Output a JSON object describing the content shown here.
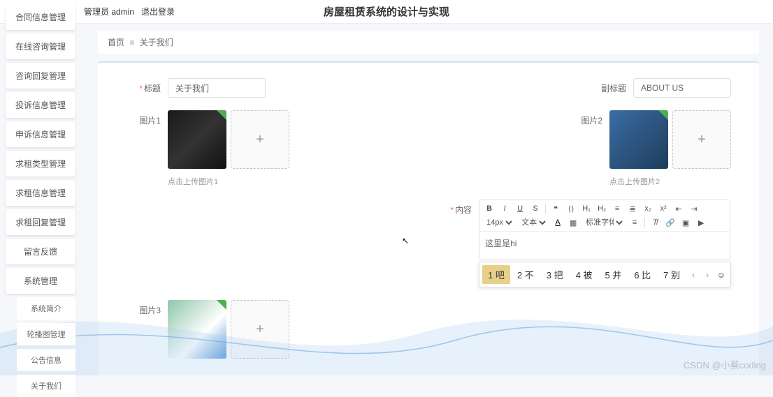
{
  "header": {
    "title": "房屋租赁系统的设计与实现",
    "user_label": "管理员 admin",
    "logout": "退出登录"
  },
  "sidebar": {
    "items": [
      "合同信息管理",
      "在线咨询管理",
      "咨询回复管理",
      "投诉信息管理",
      "申诉信息管理",
      "求租类型管理",
      "求租信息管理",
      "求租回复管理",
      "留言反馈",
      "系统管理"
    ],
    "subitems": [
      "系统简介",
      "轮播图管理",
      "公告信息",
      "关于我们"
    ]
  },
  "breadcrumb": {
    "root": "首页",
    "current": "关于我们"
  },
  "form": {
    "title_label": "标题",
    "title_value": "关于我们",
    "subtitle_label": "副标题",
    "subtitle_value": "ABOUT US",
    "img1_label": "图片1",
    "img1_hint": "点击上传图片1",
    "img2_label": "图片2",
    "img2_hint": "点击上传图片2",
    "img3_label": "图片3",
    "content_label": "内容",
    "required": "*"
  },
  "editor": {
    "font_size": "14px",
    "font_menu": "文本",
    "font_family": "标准字体",
    "body_text": "这里是hi"
  },
  "ime": {
    "candidates": [
      "1 吧",
      "2 不",
      "3 把",
      "4 被",
      "5 并",
      "6 比",
      "7 别"
    ]
  },
  "watermark": "CSDN @小蔡coding"
}
